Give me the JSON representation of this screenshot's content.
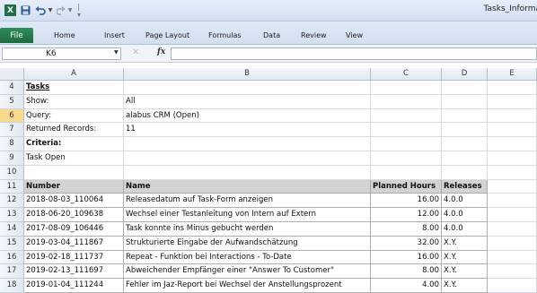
{
  "app": {
    "title": "Tasks_Informa",
    "logo": "X",
    "accent": "#1e7145"
  },
  "ribbon": {
    "file_tab": "File",
    "tabs": [
      "Home",
      "Insert",
      "Page Layout",
      "Formulas",
      "Data",
      "Review",
      "View"
    ]
  },
  "formula_bar": {
    "name_box": "K6",
    "fx": "fx",
    "cancel": "✕",
    "formula": ""
  },
  "grid": {
    "columns": [
      "A",
      "B",
      "C",
      "D",
      "E"
    ],
    "active_row": "6",
    "info_rows": [
      {
        "row": "4",
        "a": "Tasks",
        "b": ""
      },
      {
        "row": "5",
        "a": "Show:",
        "b": "All"
      },
      {
        "row": "6",
        "a": "Query:",
        "b": "alabus CRM (Open)"
      },
      {
        "row": "7",
        "a": "Returned Records:",
        "b": "11"
      },
      {
        "row": "8",
        "a": "Criteria:",
        "b": ""
      },
      {
        "row": "9",
        "a": "Task Open",
        "b": ""
      },
      {
        "row": "10",
        "a": "",
        "b": ""
      }
    ],
    "table_header": {
      "row": "11",
      "number": "Number",
      "name": "Name",
      "planned_hours": "Planned Hours",
      "releases": "Releases"
    },
    "table_rows": [
      {
        "row": "12",
        "number": "2018-08-03_110064",
        "name": "Releasedatum auf Task-Form anzeigen",
        "hours": "16.00",
        "release": "4.0.0"
      },
      {
        "row": "13",
        "number": "2018-06-20_109638",
        "name": "Wechsel einer Testanleitung von Intern auf Extern",
        "hours": "12.00",
        "release": "4.0.0"
      },
      {
        "row": "14",
        "number": "2017-08-09_106446",
        "name": "Task konnte ins Minus gebucht werden",
        "hours": "8.00",
        "release": "4.0.0"
      },
      {
        "row": "15",
        "number": "2019-03-04_111867",
        "name": "Strukturierte Eingabe der Aufwandschätzung",
        "hours": "32.00",
        "release": "X.Y."
      },
      {
        "row": "16",
        "number": "2019-02-18_111737",
        "name": "Repeat - Funktion bei Interactions - To-Date",
        "hours": "16.00",
        "release": "X.Y."
      },
      {
        "row": "17",
        "number": "2019-02-13_111697",
        "name": "Abweichender Empfänger einer \"Answer To Customer\"",
        "hours": "8.00",
        "release": "X.Y."
      },
      {
        "row": "18",
        "number": "2019-01-04_111244",
        "name": "Fehler im Jaz-Report bei Wechsel der Anstellungsprozent",
        "hours": "4.00",
        "release": "X.Y."
      }
    ]
  }
}
